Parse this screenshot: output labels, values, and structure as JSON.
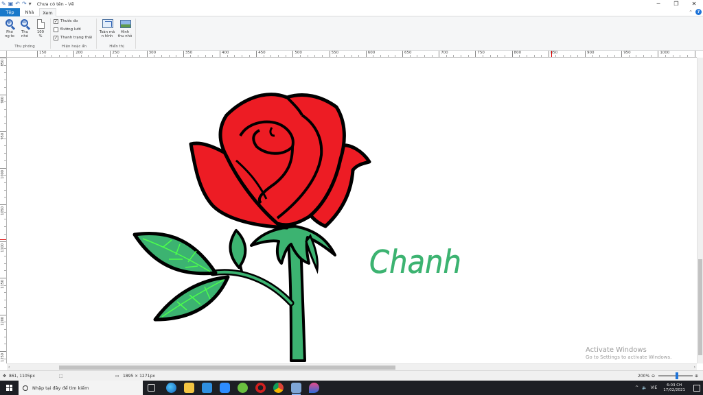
{
  "app": {
    "window_title": "Chưa có tên - Vẽ",
    "qat_icons": [
      "paint-icon",
      "save-icon",
      "undo-icon",
      "redo-icon",
      "customize-qat-icon"
    ],
    "window_controls": [
      "minimize",
      "maximize",
      "close"
    ]
  },
  "tabs": [
    {
      "label": "Tệp",
      "selected": false
    },
    {
      "label": "Nhà",
      "selected": false
    },
    {
      "label": "Xem",
      "selected": true
    }
  ],
  "ribbon": {
    "zoom_group": {
      "label": "Thu phóng",
      "zoom_in": "Phó\nng to",
      "zoom_out": "Thu\nnhỏ",
      "hundred": "100\n%"
    },
    "show_hide_group": {
      "label": "Hiện hoặc ẩn",
      "checkboxes": [
        {
          "label": "Thước đo",
          "checked": true
        },
        {
          "label": "Đường lưới",
          "checked": false
        },
        {
          "label": "Thanh trạng thái",
          "checked": true
        }
      ]
    },
    "display_group": {
      "label": "Hiển thị",
      "fullscreen": "Toàn mà\nn hình",
      "thumbnail": "Hình\nthu nhỏ"
    }
  },
  "ruler": {
    "h_ticks": [
      "150",
      "200",
      "250",
      "300",
      "350",
      "400",
      "450",
      "500",
      "550",
      "600",
      "650",
      "700",
      "750",
      "800",
      "850",
      "900",
      "950",
      "1000",
      "1050"
    ],
    "v_ticks": [
      "850",
      "900",
      "950",
      "1000",
      "1050",
      "1100",
      "1150",
      "1200",
      "1250"
    ]
  },
  "canvas": {
    "handwriting": "Chanh",
    "colors": {
      "petal": "#ed1c24",
      "outline": "#000000",
      "leaf": "#3cb371",
      "leaf_vein": "#4cff4c",
      "text": "#3cb371"
    }
  },
  "watermark": {
    "line1": "Activate Windows",
    "line2": "Go to Settings to activate Windows."
  },
  "status": {
    "cursor_pos": "861, 1105px",
    "image_size": "1895 × 1271px",
    "zoom": "200%",
    "zoom_level": 0.55
  },
  "taskbar": {
    "search_placeholder": "Nhập tại đây để tìm kiếm",
    "language": "VIE",
    "time": "6:03 CH",
    "date": "17/02/2021",
    "tray_arrow": "^"
  }
}
